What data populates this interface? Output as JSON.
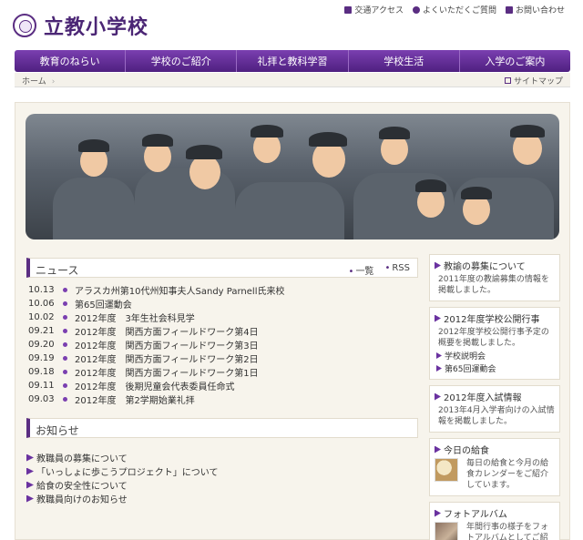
{
  "header": {
    "school_name": "立教小学校",
    "util_links": [
      "交通アクセス",
      "よくいただくご質問",
      "お問い合わせ"
    ]
  },
  "nav": [
    "教育のねらい",
    "学校のご紹介",
    "礼拝と教科学習",
    "学校生活",
    "入学のご案内"
  ],
  "breadcrumb": {
    "home": "ホーム",
    "sitemap": "サイトマップ"
  },
  "news": {
    "title": "ニュース",
    "link_list": "一覧",
    "link_rss": "RSS",
    "items": [
      {
        "date": "10.13",
        "text": "アラスカ州第10代州知事夫人Sandy Parnell氏来校"
      },
      {
        "date": "10.06",
        "text": "第65回運動会"
      },
      {
        "date": "10.02",
        "text": "2012年度　3年生社会科見学"
      },
      {
        "date": "09.21",
        "text": "2012年度　関西方面フィールドワーク第4日"
      },
      {
        "date": "09.20",
        "text": "2012年度　関西方面フィールドワーク第3日"
      },
      {
        "date": "09.19",
        "text": "2012年度　関西方面フィールドワーク第2日"
      },
      {
        "date": "09.18",
        "text": "2012年度　関西方面フィールドワーク第1日"
      },
      {
        "date": "09.11",
        "text": "2012年度　後期児童会代表委員任命式"
      },
      {
        "date": "09.03",
        "text": "2012年度　第2学期始業礼拝"
      }
    ]
  },
  "oshirase": {
    "title": "お知らせ",
    "items": [
      "教職員の募集について",
      "「いっしょに歩こうプロジェクト」について",
      "給食の安全性について",
      "教職員向けのお知らせ"
    ]
  },
  "sidebar": {
    "recruit": {
      "title": "教諭の募集について",
      "desc": "2011年度の教諭募集の情報を掲載しました。"
    },
    "events": {
      "title": "2012年度学校公開行事",
      "desc": "2012年度学校公開行事予定の概要を掲載しました。",
      "sub1": "学校説明会",
      "sub2": "第65回運動会"
    },
    "admission": {
      "title": "2012年度入試情報",
      "desc": "2013年4月入学者向けの入試情報を掲載しました。"
    },
    "lunch": {
      "title": "今日の給食",
      "desc": "毎日の給食と今月の給食カレンダーをご紹介しています。"
    },
    "album": {
      "title": "フォトアルバム",
      "desc": "年間行事の様子をフォトアルバムとしてご紹介しています。"
    }
  }
}
